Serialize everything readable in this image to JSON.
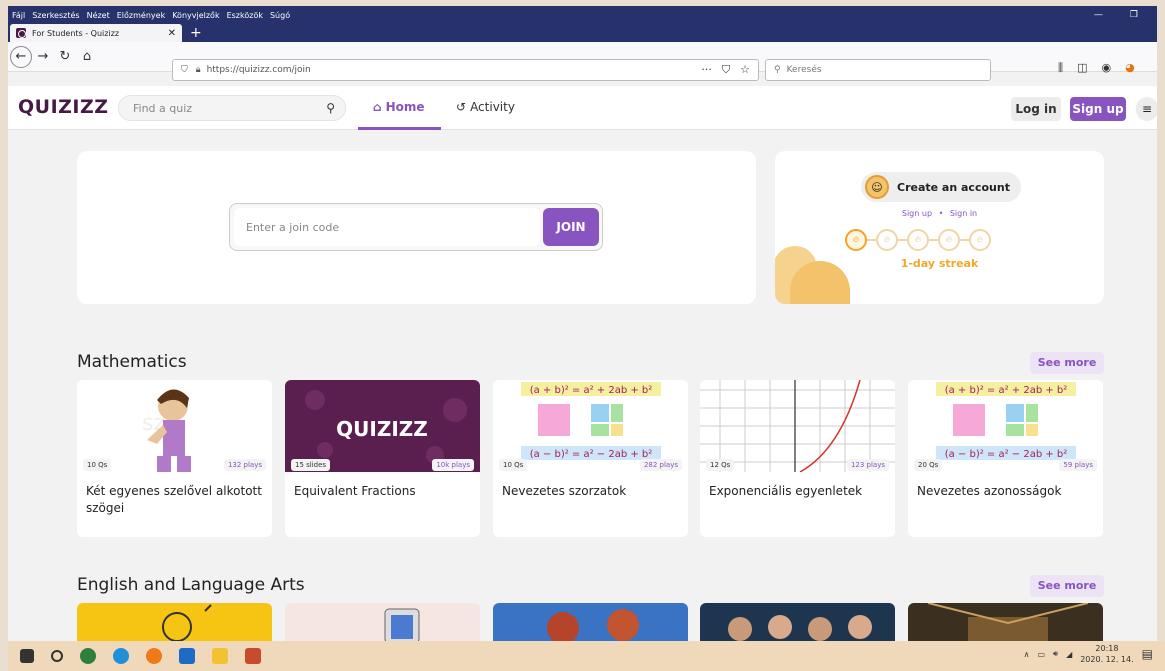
{
  "menubar": [
    "Fájl",
    "Szerkesztés",
    "Nézet",
    "Előzmények",
    "Könyvjelzők",
    "Eszközök",
    "Súgó"
  ],
  "tab": {
    "title": "For Students - Quizizz"
  },
  "url": "https://quizizz.com/join",
  "browser_search_placeholder": "Keresés",
  "header": {
    "logo": "QUIZIZZ",
    "search_placeholder": "Find a quiz",
    "home": "Home",
    "activity": "Activity",
    "login": "Log in",
    "signup": "Sign up"
  },
  "join": {
    "placeholder": "Enter a join code",
    "button": "JOIN"
  },
  "account": {
    "create": "Create an account",
    "signup": "Sign up",
    "dot": "•",
    "signin": "Sign in",
    "streak": "1-day streak"
  },
  "sections": [
    {
      "title": "Mathematics",
      "see_more": "See more",
      "cards": [
        {
          "count": "10 Qs",
          "plays": "132 plays",
          "title": "Két egyenes szelővel alkotott szögei"
        },
        {
          "count": "15 slides",
          "plays": "10k plays",
          "title": "Equivalent Fractions"
        },
        {
          "count": "10 Qs",
          "plays": "282 plays",
          "title": "Nevezetes szorzatok"
        },
        {
          "count": "12 Qs",
          "plays": "123 plays",
          "title": "Exponenciális egyenletek"
        },
        {
          "count": "20 Qs",
          "plays": "59 plays",
          "title": "Nevezetes azonosságok"
        }
      ]
    },
    {
      "title": "English and Language Arts",
      "see_more": "See more"
    }
  ],
  "math_image_text": {
    "top": "(a + b)² = a² + 2ab + b²",
    "bottom": "(a − b)² = a² − 2ab + b²"
  },
  "clock": {
    "time": "20:18",
    "date": "2020. 12. 14."
  },
  "colors": {
    "brand": "#8854c0",
    "logo": "#461a42",
    "streak": "#f2a521"
  }
}
